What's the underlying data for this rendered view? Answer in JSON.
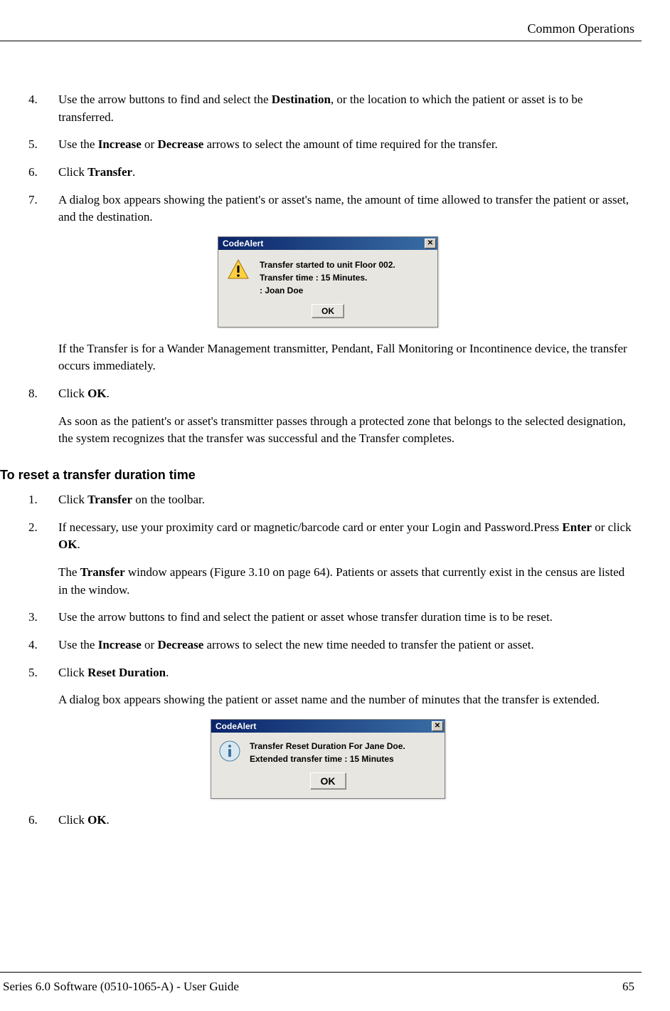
{
  "header": {
    "section_title": "Common Operations"
  },
  "list1": [
    {
      "num": "4.",
      "html": "Use the arrow buttons to find and select the <b>Destination</b>, or the location to which the patient or asset is to be transferred."
    },
    {
      "num": "5.",
      "html": "Use the <b>Increase</b> or <b>Decrease</b> arrows to select the amount of time required for the transfer."
    },
    {
      "num": "6.",
      "html": "Click <b>Transfer</b>."
    },
    {
      "num": "7.",
      "html": "A dialog box appears showing the patient's or asset's name, the amount of time allowed to transfer the patient or asset, and the destination."
    }
  ],
  "dialog1": {
    "title": "CodeAlert",
    "line1": "Transfer started to unit Floor 002.",
    "line2": "Transfer time : 15 Minutes.",
    "line3": ": Joan Doe",
    "ok": "OK"
  },
  "after_dialog1": [
    {
      "html": "If the Transfer is for a Wander Management transmitter, Pendant, Fall Monitoring or Incontinence device, the transfer occurs immediately."
    }
  ],
  "list1b": [
    {
      "num": "8.",
      "html": "Click <b>OK</b>.",
      "after": "As soon as the patient's or asset's transmitter passes through a protected zone that belongs to the selected designation, the system recognizes that the transfer was successful and the Transfer completes."
    }
  ],
  "section2_heading": "To reset a transfer duration time",
  "list2": [
    {
      "num": "1.",
      "html": "Click <b>Transfer</b> on the toolbar."
    },
    {
      "num": "2.",
      "html": "If necessary, use your proximity card or magnetic/barcode card or enter your Login and Password.Press <b>Enter</b> or click <b>OK</b>.",
      "after": "The <b>Transfer</b> window appears (Figure 3.10 on page 64). Patients or assets that currently exist in the census are listed in the window."
    },
    {
      "num": "3.",
      "html": "Use the arrow buttons to find and select the patient or asset whose transfer duration time is to be reset."
    },
    {
      "num": "4.",
      "html": "Use the <b>Increase</b> or <b>Decrease</b> arrows to select the new time needed to transfer the patient or asset."
    },
    {
      "num": "5.",
      "html": "Click <b>Reset Duration</b>.",
      "after": "A dialog box appears showing the patient or asset name and the number of minutes that the transfer is extended."
    }
  ],
  "dialog2": {
    "title": "CodeAlert",
    "line1": "Transfer Reset Duration For Jane Doe.",
    "line2": "Extended transfer time : 15 Minutes",
    "ok": "OK"
  },
  "list2b": [
    {
      "num": "6.",
      "html": "Click <b>OK</b>."
    }
  ],
  "footer": {
    "left": "Series 6.0 Software (0510-1065-A) - User Guide",
    "right": "65"
  }
}
